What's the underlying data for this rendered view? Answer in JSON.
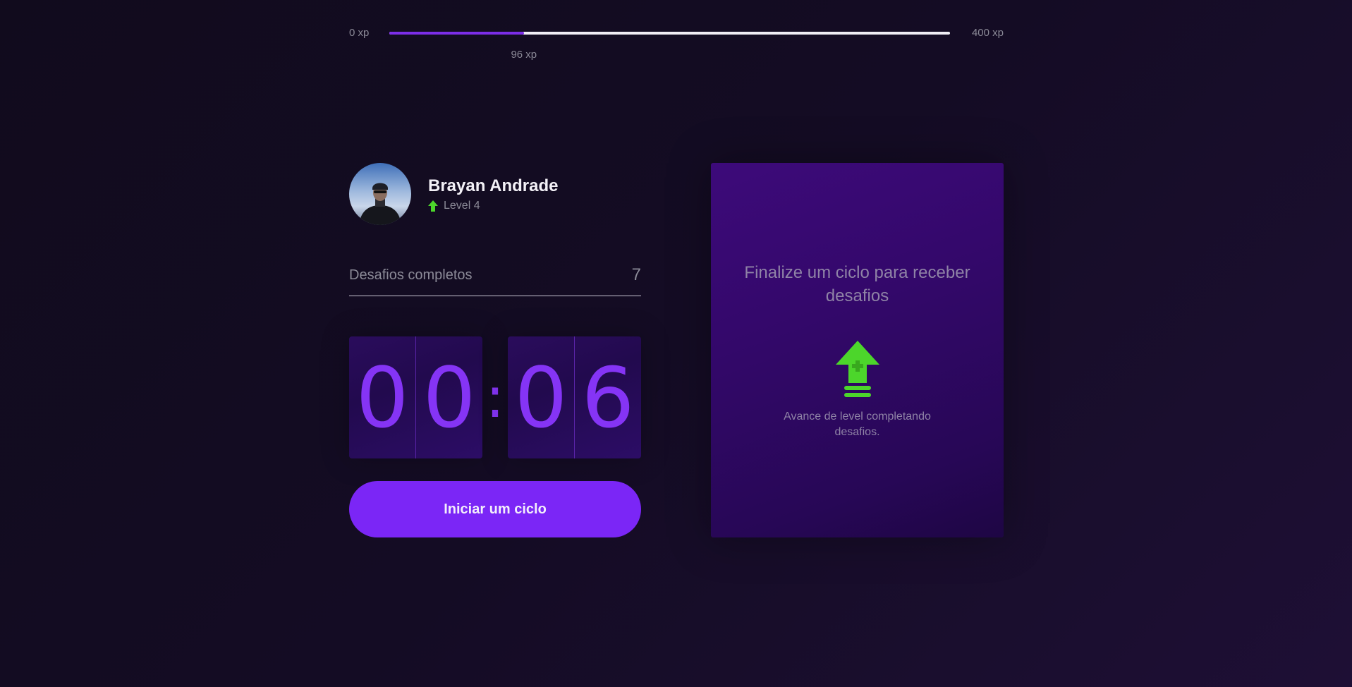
{
  "xp_bar": {
    "min_label": "0 xp",
    "max_label": "400 xp",
    "current_label": "96 xp",
    "current": 96,
    "max": 400
  },
  "profile": {
    "name": "Brayan Andrade",
    "level_label": "Level 4",
    "level_icon": "level-up-arrow-icon"
  },
  "completed_challenges": {
    "label": "Desafios completos",
    "value": "7"
  },
  "countdown": {
    "minute_left": "0",
    "minute_right": "0",
    "separator": ":",
    "second_left": "0",
    "second_right": "6"
  },
  "start_button": {
    "label": "Iniciar um ciclo"
  },
  "challenge_box": {
    "title": "Finalize um ciclo para receber desafios",
    "icon": "level-up-icon",
    "description": "Avance de level completando desafios."
  },
  "colors": {
    "accent": "#7b26f6",
    "green": "#4cd62b",
    "background": "#120b20"
  }
}
